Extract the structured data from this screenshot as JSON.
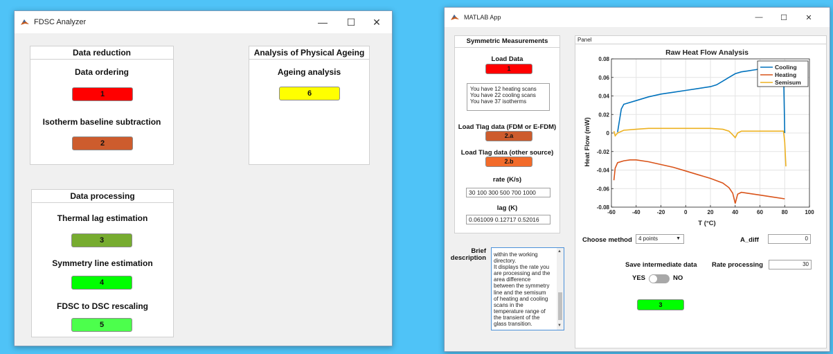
{
  "fdsc": {
    "title": "FDSC Analyzer",
    "controls": {
      "minimize": "—",
      "maximize": "☐",
      "close": "✕"
    },
    "data_reduction": {
      "title": "Data reduction",
      "ordering_label": "Data ordering",
      "ordering_button": "1",
      "ordering_color": "#ff0000",
      "isotherm_label": "Isotherm baseline subtraction",
      "isotherm_button": "2",
      "isotherm_color": "#cd5c2d"
    },
    "ageing": {
      "title": "Analysis of Physical Ageing",
      "label": "Ageing analysis",
      "button": "6",
      "color": "#ffff00"
    },
    "data_processing": {
      "title": "Data processing",
      "thermal_label": "Thermal lag estimation",
      "thermal_button": "3",
      "thermal_color": "#77ac30",
      "symmetry_label": "Symmetry line estimation",
      "symmetry_button": "4",
      "symmetry_color": "#00ff00",
      "rescaling_label": "FDSC to DSC rescaling",
      "rescaling_button": "5",
      "rescaling_color": "#4cff4c"
    }
  },
  "matlab": {
    "title": "MATLAB App",
    "controls": {
      "minimize": "—",
      "maximize": "☐",
      "close": "✕"
    },
    "symmetric": {
      "title": "Symmetric Measurements",
      "load_data_label": "Load Data",
      "load_data_button": "1",
      "status_lines": [
        "You have 12 heating scans",
        "You have 22 cooling scans",
        "You have 37 isotherms"
      ],
      "tlag_fdm_label": "Load Tlag data (FDM or E-FDM)",
      "tlag_fdm_button": "2.a",
      "tlag_other_label": "Load Tlag data (other source)",
      "tlag_other_button": "2.b",
      "rate_label": "rate (K/s)",
      "rate_value": "30  100  300  500  700  1000",
      "lag_label": "lag (K)",
      "lag_value": "0.061009    0.12717    0.52016"
    },
    "description": {
      "label_line1": "Brief",
      "label_line2": "description",
      "lines": [
        "within the working",
        "directory.",
        "It displays the rate you",
        "are processing and the",
        "area difference",
        "between the symmetry",
        "line and the semisum",
        "of heating and cooling",
        "scans in the",
        "temperature range of",
        "the transient of the",
        "glass transition."
      ]
    },
    "panel": {
      "title": "Panel",
      "method_label": "Choose method",
      "method_value": "4 points",
      "adiff_label": "A_diff",
      "adiff_value": "0",
      "save_label": "Save intermediate data",
      "rate_proc_label": "Rate processing",
      "rate_proc_value": "30",
      "yes_label": "YES",
      "no_label": "NO",
      "run_button": "3"
    }
  },
  "chart_data": {
    "type": "line",
    "title": "Raw Heat Flow Analysis",
    "xlabel": "T (°C)",
    "ylabel": "Heat Flow (mW)",
    "xlim": [
      -60,
      100
    ],
    "ylim": [
      -0.08,
      0.08
    ],
    "xticks": [
      "-60",
      "-40",
      "-20",
      "0",
      "20",
      "40",
      "60",
      "80",
      "100"
    ],
    "yticks": [
      "-0.08",
      "-0.06",
      "-0.04",
      "-0.02",
      "0",
      "0.02",
      "0.04",
      "0.06",
      "0.08"
    ],
    "grid": true,
    "legend": "top-right",
    "series": [
      {
        "name": "Cooling",
        "color": "#0072bd",
        "x": [
          -55,
          -52,
          -50,
          -40,
          -30,
          -20,
          -10,
          0,
          10,
          20,
          25,
          30,
          35,
          40,
          45,
          50,
          55,
          60,
          65,
          70,
          75,
          78,
          79,
          80
        ],
        "y": [
          0.001,
          0.026,
          0.031,
          0.035,
          0.039,
          0.042,
          0.044,
          0.046,
          0.048,
          0.05,
          0.052,
          0.056,
          0.06,
          0.064,
          0.066,
          0.067,
          0.068,
          0.069,
          0.07,
          0.071,
          0.072,
          0.074,
          0.07,
          0.0
        ]
      },
      {
        "name": "Heating",
        "color": "#d95319",
        "x": [
          -58,
          -57,
          -55,
          -50,
          -45,
          -40,
          -30,
          -20,
          -10,
          0,
          10,
          20,
          30,
          35,
          38,
          40,
          42,
          45,
          50,
          60,
          70,
          80
        ],
        "y": [
          -0.051,
          -0.038,
          -0.032,
          -0.03,
          -0.029,
          -0.029,
          -0.031,
          -0.034,
          -0.037,
          -0.041,
          -0.045,
          -0.049,
          -0.054,
          -0.059,
          -0.065,
          -0.076,
          -0.066,
          -0.064,
          -0.065,
          -0.067,
          -0.069,
          -0.071
        ]
      },
      {
        "name": "Semisum",
        "color": "#edb120",
        "x": [
          -58,
          -57,
          -55,
          -50,
          -40,
          -30,
          -20,
          -10,
          0,
          10,
          20,
          30,
          35,
          38,
          40,
          42,
          45,
          50,
          60,
          70,
          79,
          80,
          81
        ],
        "y": [
          0.002,
          -0.003,
          0.0,
          0.003,
          0.004,
          0.005,
          0.005,
          0.005,
          0.005,
          0.005,
          0.005,
          0.004,
          0.002,
          -0.002,
          -0.005,
          0.0,
          0.002,
          0.002,
          0.002,
          0.002,
          0.002,
          -0.01,
          -0.036
        ]
      }
    ]
  }
}
